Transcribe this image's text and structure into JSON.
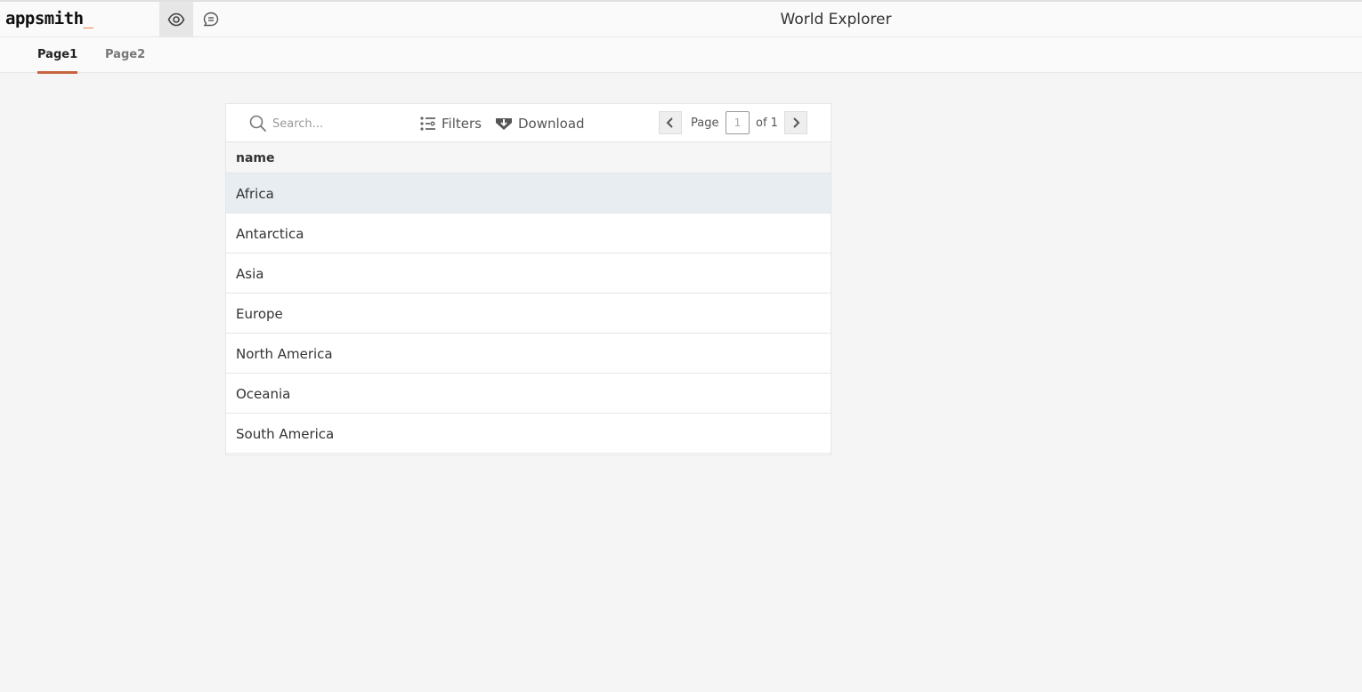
{
  "topbar": {
    "logo_text": "appsmith",
    "logo_cursor": "_",
    "title": "World Explorer",
    "icons": [
      "eye-icon",
      "comment-icon"
    ]
  },
  "pages": {
    "tabs": [
      {
        "label": "Page1",
        "active": true
      },
      {
        "label": "Page2",
        "active": false
      }
    ]
  },
  "table": {
    "search_placeholder": "Search...",
    "filters_label": "Filters",
    "download_label": "Download",
    "pagination": {
      "page_label": "Page",
      "current_page": "1",
      "of_label": "of 1"
    },
    "columns": [
      "name"
    ],
    "rows": [
      "Africa",
      "Antarctica",
      "Asia",
      "Europe",
      "North America",
      "Oceania",
      "South America"
    ],
    "selected_row": "Africa"
  },
  "colors": {
    "accent": "#c7643d",
    "background": "#f5f5f5",
    "selected_row": "#e8edf2"
  }
}
